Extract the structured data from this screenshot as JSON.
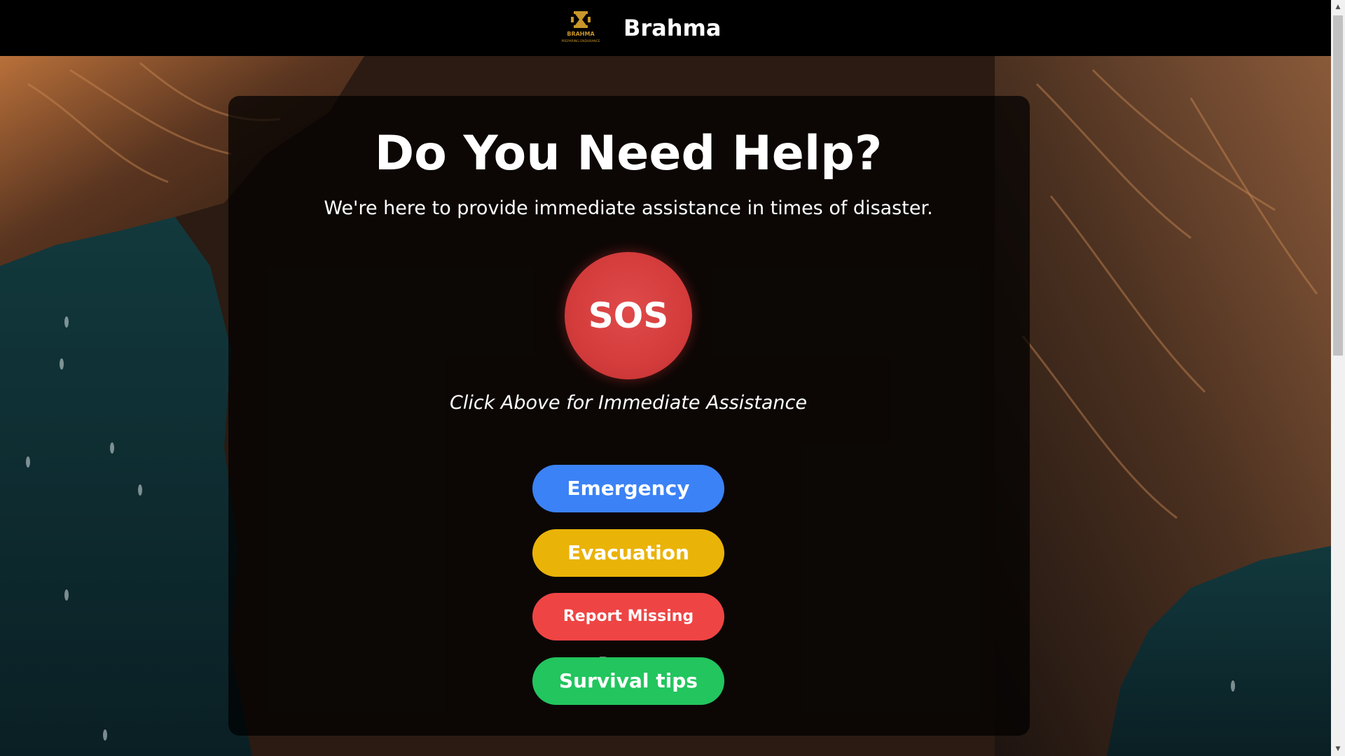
{
  "header": {
    "brand": "Brahma",
    "logo_text": "BRAHMA",
    "logo_tagline": "PREPARING ENDURANCE"
  },
  "hero": {
    "title": "Do You Need Help?",
    "subtitle": "We're here to provide immediate assistance in times of disaster.",
    "sos_label": "SOS",
    "sos_caption": "Click Above for Immediate Assistance"
  },
  "actions": [
    {
      "label": "Emergency",
      "color": "#3b82f6"
    },
    {
      "label": "Evacuation",
      "color": "#eab308"
    },
    {
      "label": "Report Missing Person",
      "color": "#ef4444"
    },
    {
      "label": "Survival tips",
      "color": "#22c55e"
    }
  ],
  "colors": {
    "sos": "#d43c3c",
    "header_bg": "#000000",
    "brand_gold": "#c9962b"
  },
  "scrollbar": {
    "up_icon": "arrow-up-icon",
    "down_icon": "arrow-down-icon"
  }
}
